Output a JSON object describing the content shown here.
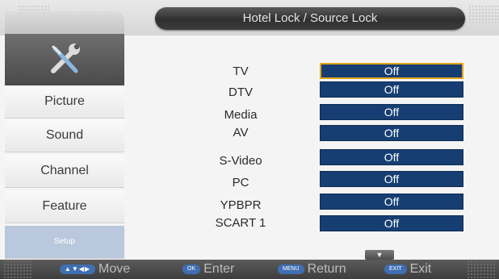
{
  "header": {
    "title": "Hotel Lock / Source Lock"
  },
  "sidebar": {
    "icon": "tools-icon",
    "items": [
      {
        "label": "Picture"
      },
      {
        "label": "Sound"
      },
      {
        "label": "Channel"
      },
      {
        "label": "Feature"
      },
      {
        "label": "Setup",
        "active": true
      }
    ]
  },
  "sources": [
    {
      "label": "TV",
      "value": "Off",
      "selected": true
    },
    {
      "label": "DTV",
      "value": "Off"
    },
    {
      "label": "Media",
      "value": "Off"
    },
    {
      "label": "AV",
      "value": "Off"
    },
    {
      "label": "S-Video",
      "value": "Off"
    },
    {
      "label": "PC",
      "value": "Off"
    },
    {
      "label": "YPBPR",
      "value": "Off"
    },
    {
      "label": "SCART 1",
      "value": "Off"
    }
  ],
  "footer": {
    "move": {
      "key": "▲▼◀▶",
      "label": "Move"
    },
    "enter": {
      "key": "OK",
      "label": "Enter"
    },
    "return": {
      "key": "MENU",
      "label": "Return"
    },
    "exit": {
      "key": "EXIT",
      "label": "Exit"
    }
  },
  "colors": {
    "value_bg": "#163e72",
    "selected_border": "#e2a518",
    "active_nav": "#b9c8dc"
  }
}
